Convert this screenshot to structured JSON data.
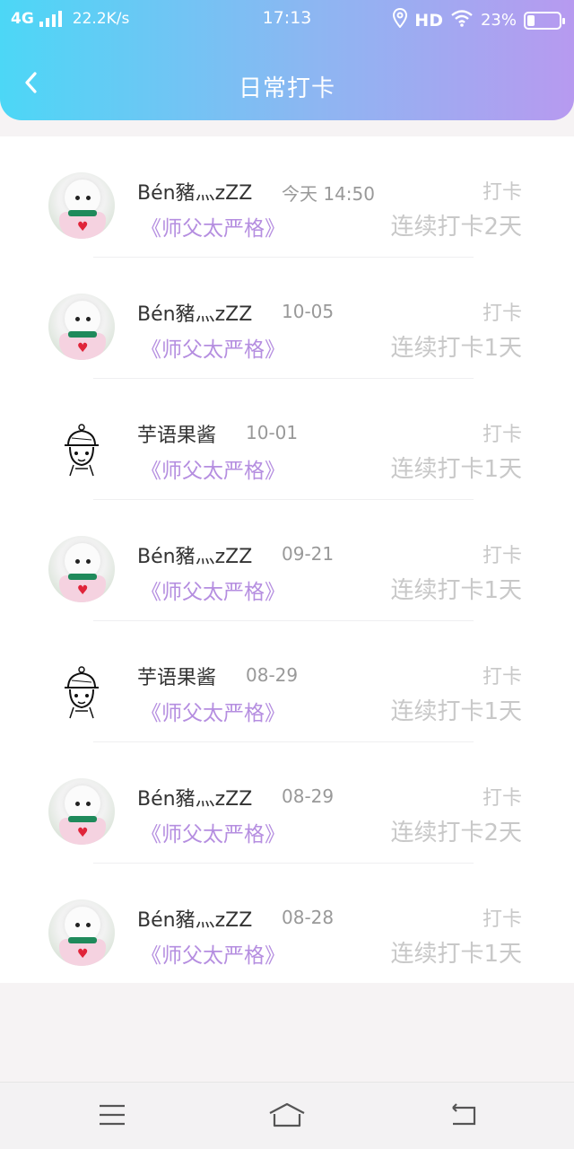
{
  "status_bar": {
    "network": "4G",
    "speed": "22.2K/s",
    "time": "17:13",
    "hd": "HD",
    "battery_text": "23%",
    "battery_level": 0.23
  },
  "nav": {
    "title": "日常打卡",
    "back_icon": "chevron-left-icon"
  },
  "entries": [
    {
      "user": "Bén豬灬zZZ",
      "time": "今天  14:50",
      "book": "《师父太严格》",
      "checkin": "打卡",
      "streak": "连续打卡2天",
      "avatar": "dog"
    },
    {
      "user": "Bén豬灬zZZ",
      "time": "10-05",
      "book": "《师父太严格》",
      "checkin": "打卡",
      "streak": "连续打卡1天",
      "avatar": "dog"
    },
    {
      "user": "芋语果酱",
      "time": "10-01",
      "book": "《师父太严格》",
      "checkin": "打卡",
      "streak": "连续打卡1天",
      "avatar": "sketch"
    },
    {
      "user": "Bén豬灬zZZ",
      "time": "09-21",
      "book": "《师父太严格》",
      "checkin": "打卡",
      "streak": "连续打卡1天",
      "avatar": "dog"
    },
    {
      "user": "芋语果酱",
      "time": "08-29",
      "book": "《师父太严格》",
      "checkin": "打卡",
      "streak": "连续打卡1天",
      "avatar": "sketch"
    },
    {
      "user": "Bén豬灬zZZ",
      "time": "08-29",
      "book": "《师父太严格》",
      "checkin": "打卡",
      "streak": "连续打卡2天",
      "avatar": "dog"
    },
    {
      "user": "Bén豬灬zZZ",
      "time": "08-28",
      "book": "《师父太严格》",
      "checkin": "打卡",
      "streak": "连续打卡1天",
      "avatar": "dog"
    }
  ],
  "system_nav": {
    "menu_icon": "menu-icon",
    "home_icon": "home-icon",
    "back_icon": "back-arrow-icon"
  },
  "colors": {
    "header_gradient_start": "#4cd7f6",
    "header_gradient_end": "#b79af0",
    "book_title": "#b58ee0",
    "muted": "#c8c8c8"
  }
}
